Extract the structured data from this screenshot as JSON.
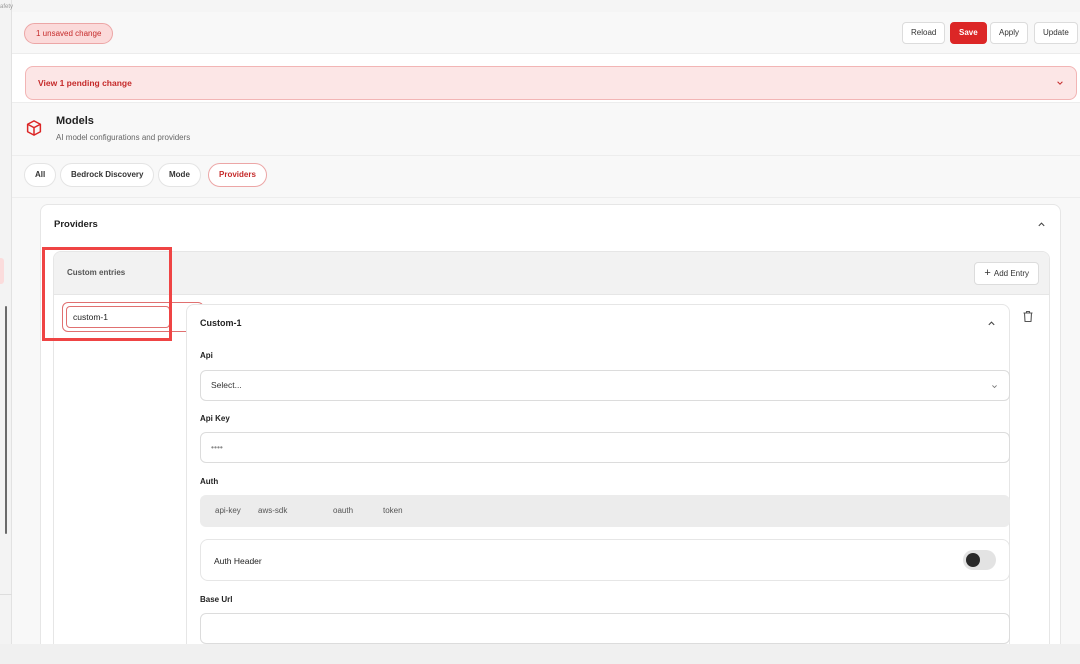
{
  "left_strip": {
    "fragment": "afety"
  },
  "topbar": {
    "unsaved_badge": "1 unsaved change",
    "reload_label": "Reload",
    "save_label": "Save",
    "apply_label": "Apply",
    "update_label": "Update"
  },
  "pending_banner": {
    "label": "View 1 pending change"
  },
  "section": {
    "icon": "cube-icon",
    "title": "Models",
    "subtitle": "AI model configurations and providers"
  },
  "tabs": [
    {
      "label": "All"
    },
    {
      "label": "Bedrock Discovery"
    },
    {
      "label": "Mode"
    },
    {
      "label": "Providers",
      "active": true
    }
  ],
  "providers": {
    "title": "Providers",
    "custom_entries": {
      "title": "Custom entries",
      "add_label": "Add Entry",
      "entry_key_value": "custom-1",
      "entry": {
        "title": "Custom-1",
        "api": {
          "label": "Api",
          "value": "Select..."
        },
        "api_key": {
          "label": "Api Key",
          "value": "••••"
        },
        "auth": {
          "label": "Auth",
          "options": [
            "api-key",
            "aws-sdk",
            "oauth",
            "token"
          ]
        },
        "auth_header": {
          "label": "Auth Header",
          "enabled": false
        },
        "base_url": {
          "label": "Base Url",
          "value": ""
        }
      }
    }
  },
  "colors": {
    "accent": "#dc2626",
    "accent_soft": "#fce6e6",
    "highlight": "#ef4444"
  }
}
